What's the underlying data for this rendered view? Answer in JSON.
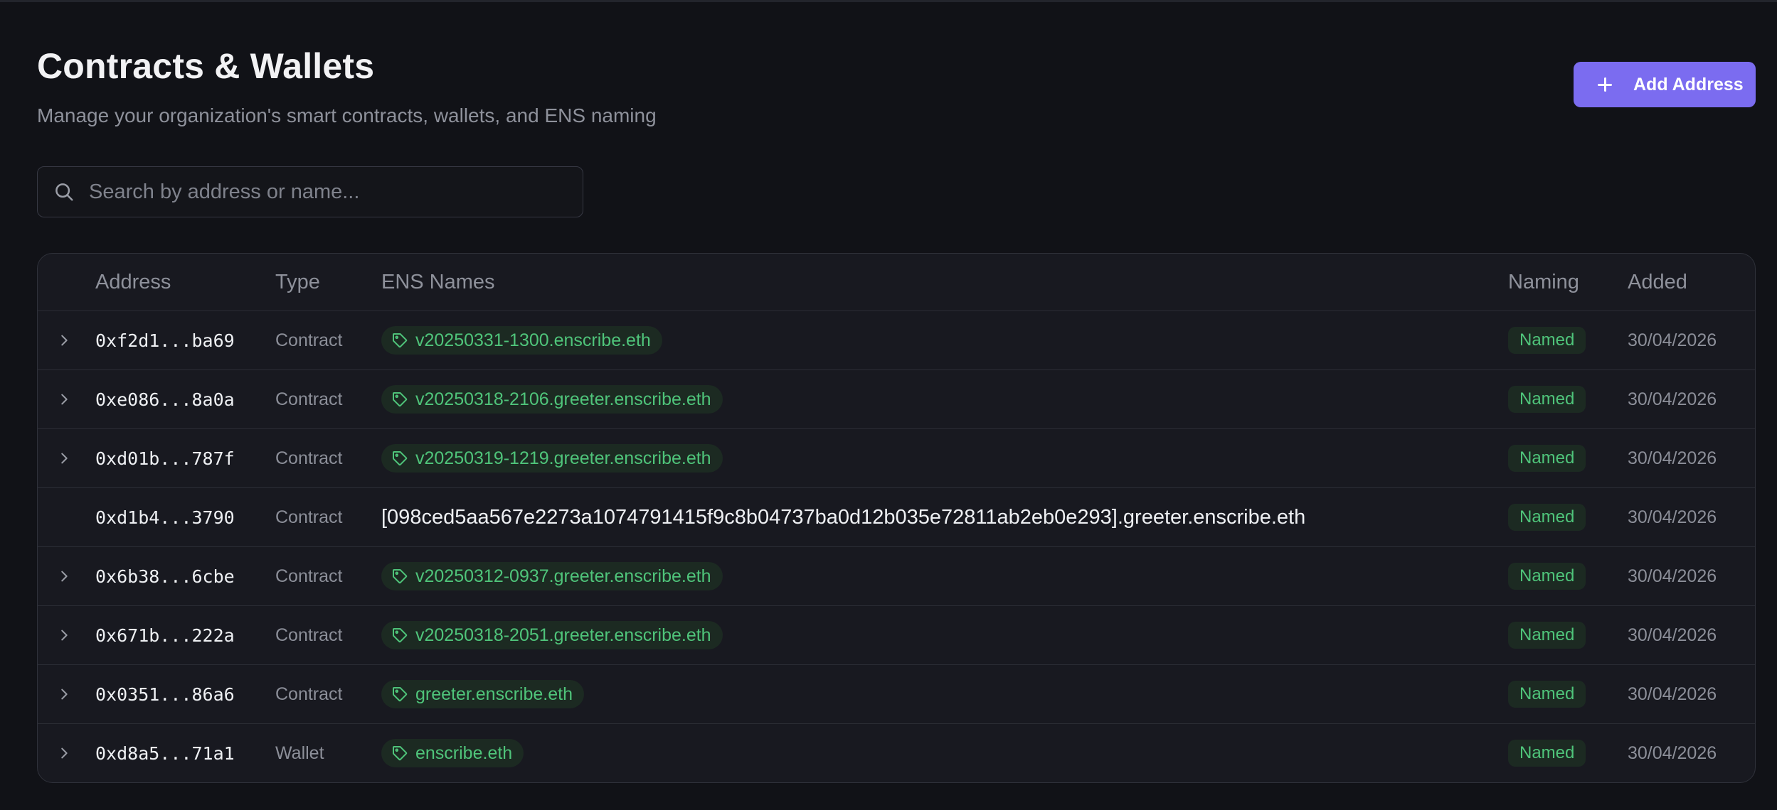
{
  "header": {
    "title": "Contracts & Wallets",
    "subtitle": "Manage your organization's smart contracts, wallets, and ENS naming",
    "add_button_label": "Add Address"
  },
  "search": {
    "placeholder": "Search by address or name...",
    "value": ""
  },
  "table": {
    "columns": {
      "address": "Address",
      "type": "Type",
      "ens": "ENS Names",
      "naming": "Naming",
      "added": "Added"
    },
    "rows": [
      {
        "address": "0xf2d1...ba69",
        "type": "Contract",
        "ens": "v20250331-1300.enscribe.eth",
        "naming": "Named",
        "added": "30/04/2026",
        "expandable": true,
        "tagged": true
      },
      {
        "address": "0xe086...8a0a",
        "type": "Contract",
        "ens": "v20250318-2106.greeter.enscribe.eth",
        "naming": "Named",
        "added": "30/04/2026",
        "expandable": true,
        "tagged": true
      },
      {
        "address": "0xd01b...787f",
        "type": "Contract",
        "ens": "v20250319-1219.greeter.enscribe.eth",
        "naming": "Named",
        "added": "30/04/2026",
        "expandable": true,
        "tagged": true
      },
      {
        "address": "0xd1b4...3790",
        "type": "Contract",
        "ens": "[098ced5aa567e2273a1074791415f9c8b04737ba0d12b035e72811ab2eb0e293].greeter.enscribe.eth",
        "naming": "Named",
        "added": "30/04/2026",
        "expandable": false,
        "tagged": false
      },
      {
        "address": "0x6b38...6cbe",
        "type": "Contract",
        "ens": "v20250312-0937.greeter.enscribe.eth",
        "naming": "Named",
        "added": "30/04/2026",
        "expandable": true,
        "tagged": true
      },
      {
        "address": "0x671b...222a",
        "type": "Contract",
        "ens": "v20250318-2051.greeter.enscribe.eth",
        "naming": "Named",
        "added": "30/04/2026",
        "expandable": true,
        "tagged": true
      },
      {
        "address": "0x0351...86a6",
        "type": "Contract",
        "ens": "greeter.enscribe.eth",
        "naming": "Named",
        "added": "30/04/2026",
        "expandable": true,
        "tagged": true
      },
      {
        "address": "0xd8a5...71a1",
        "type": "Wallet",
        "ens": "enscribe.eth",
        "naming": "Named",
        "added": "30/04/2026",
        "expandable": true,
        "tagged": true
      }
    ]
  },
  "icons": {
    "search": "search-icon",
    "add": "plus-icon",
    "expand": "chevron-right-icon",
    "tag": "tag-icon"
  },
  "colors": {
    "accent": "#7b6cf0",
    "success": "#4fc47a",
    "background": "#111217"
  }
}
